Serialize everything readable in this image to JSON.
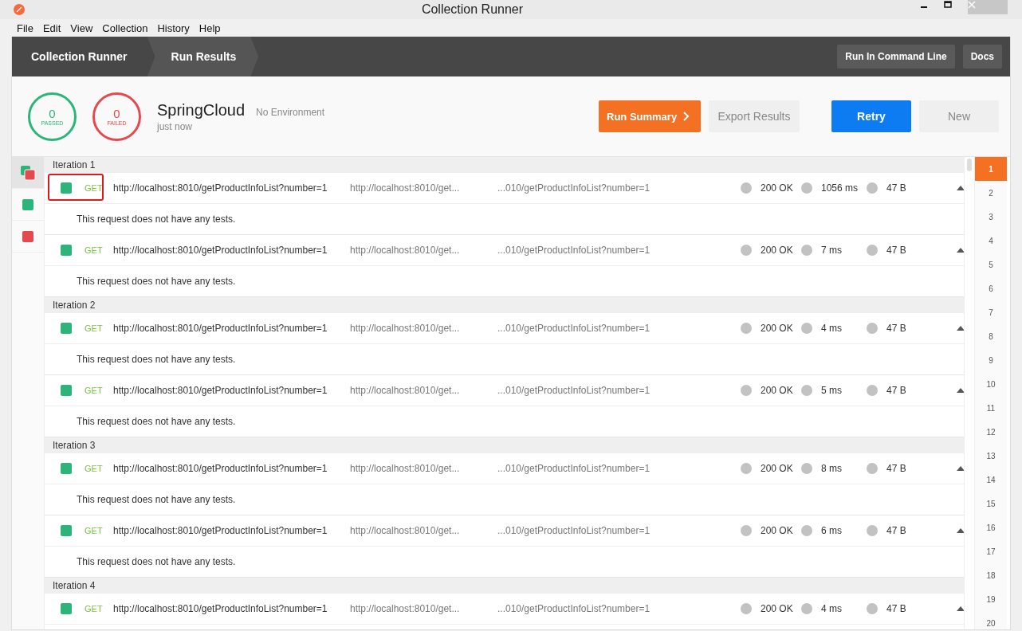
{
  "window": {
    "title": "Collection Runner"
  },
  "menu": [
    "File",
    "Edit",
    "View",
    "Collection",
    "History",
    "Help"
  ],
  "breadcrumbs": [
    {
      "label": "Collection Runner",
      "selected": false
    },
    {
      "label": "Run Results",
      "selected": true
    }
  ],
  "toolbar_buttons": [
    "Run In Command Line",
    "Docs"
  ],
  "summary": {
    "passed": {
      "count": "0",
      "label": "PASSED"
    },
    "failed": {
      "count": "0",
      "label": "FAILED"
    },
    "collection": "SpringCloud",
    "environment": "No Environment",
    "time": "just now"
  },
  "actions": [
    {
      "label": "Run Summary",
      "kind": "primary"
    },
    {
      "label": "Export Results",
      "kind": "muted"
    },
    {
      "label": "Retry",
      "kind": "accent"
    },
    {
      "label": "New",
      "kind": "muted"
    }
  ],
  "status_strip": [
    {
      "kind": "mixed",
      "selected": true
    },
    {
      "kind": "passed",
      "selected": false
    },
    {
      "kind": "failed",
      "selected": false
    }
  ],
  "iterations": [
    {
      "title": "Iteration 1",
      "requests": [
        {
          "passed": true,
          "highlighted": true,
          "method": "GET",
          "url": "http://localhost:8010/getProductInfoList?number=1",
          "column_2": "http://localhost:8010/get...",
          "column_3": "...010/getProductInfoList?number=1",
          "status": "200 OK",
          "time": "1056 ms",
          "size": "47 B",
          "tests": "This request does not have any tests."
        },
        {
          "passed": true,
          "highlighted": false,
          "method": "GET",
          "url": "http://localhost:8010/getProductInfoList?number=1",
          "column_2": "http://localhost:8010/get...",
          "column_3": "...010/getProductInfoList?number=1",
          "status": "200 OK",
          "time": "7 ms",
          "size": "47 B",
          "tests": "This request does not have any tests."
        }
      ]
    },
    {
      "title": "Iteration 2",
      "requests": [
        {
          "passed": true,
          "highlighted": false,
          "method": "GET",
          "url": "http://localhost:8010/getProductInfoList?number=1",
          "column_2": "http://localhost:8010/get...",
          "column_3": "...010/getProductInfoList?number=1",
          "status": "200 OK",
          "time": "4 ms",
          "size": "47 B",
          "tests": "This request does not have any tests."
        },
        {
          "passed": true,
          "highlighted": false,
          "method": "GET",
          "url": "http://localhost:8010/getProductInfoList?number=1",
          "column_2": "http://localhost:8010/get...",
          "column_3": "...010/getProductInfoList?number=1",
          "status": "200 OK",
          "time": "5 ms",
          "size": "47 B",
          "tests": "This request does not have any tests."
        }
      ]
    },
    {
      "title": "Iteration 3",
      "requests": [
        {
          "passed": true,
          "highlighted": false,
          "method": "GET",
          "url": "http://localhost:8010/getProductInfoList?number=1",
          "column_2": "http://localhost:8010/get...",
          "column_3": "...010/getProductInfoList?number=1",
          "status": "200 OK",
          "time": "8 ms",
          "size": "47 B",
          "tests": "This request does not have any tests."
        },
        {
          "passed": true,
          "highlighted": false,
          "method": "GET",
          "url": "http://localhost:8010/getProductInfoList?number=1",
          "column_2": "http://localhost:8010/get...",
          "column_3": "...010/getProductInfoList?number=1",
          "status": "200 OK",
          "time": "6 ms",
          "size": "47 B",
          "tests": "This request does not have any tests."
        }
      ]
    },
    {
      "title": "Iteration 4",
      "requests": [
        {
          "passed": true,
          "highlighted": false,
          "method": "GET",
          "url": "http://localhost:8010/getProductInfoList?number=1",
          "column_2": "http://localhost:8010/get...",
          "column_3": "...010/getProductInfoList?number=1",
          "status": "200 OK",
          "time": "4 ms",
          "size": "47 B"
        }
      ]
    }
  ],
  "iteration_numbers": [
    {
      "label": "1",
      "selected": true
    },
    {
      "label": "2",
      "selected": false
    },
    {
      "label": "3",
      "selected": false
    },
    {
      "label": "4",
      "selected": false
    },
    {
      "label": "5",
      "selected": false
    },
    {
      "label": "6",
      "selected": false
    },
    {
      "label": "7",
      "selected": false
    },
    {
      "label": "8",
      "selected": false
    },
    {
      "label": "9",
      "selected": false
    },
    {
      "label": "10",
      "selected": false
    },
    {
      "label": "11",
      "selected": false
    },
    {
      "label": "12",
      "selected": false
    },
    {
      "label": "13",
      "selected": false
    },
    {
      "label": "14",
      "selected": false
    },
    {
      "label": "15",
      "selected": false
    },
    {
      "label": "16",
      "selected": false
    },
    {
      "label": "17",
      "selected": false
    },
    {
      "label": "18",
      "selected": false
    },
    {
      "label": "19",
      "selected": false
    },
    {
      "label": "20",
      "selected": false
    }
  ]
}
